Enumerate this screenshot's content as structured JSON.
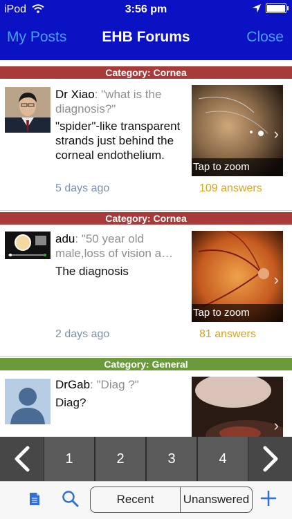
{
  "status_bar": {
    "carrier": "iPod",
    "time": "3:56 pm"
  },
  "nav": {
    "left": "My Posts",
    "title": "EHB Forums",
    "right": "Close"
  },
  "posts": [
    {
      "category": "Category: Cornea",
      "category_color": "#a83a3a",
      "author": "Dr Xiao",
      "question": ": \"what is the diagnosis?\"",
      "body": "\"spider\"-like transparent strands just behind the corneal endothelium.",
      "time": "5 days ago",
      "answers": "109 answers",
      "zoom": "Tap to zoom"
    },
    {
      "category": "Category: Cornea",
      "category_color": "#a83a3a",
      "author": "adu",
      "question": ": \"50 year old male,loss of vision a…",
      "body": "The diagnosis",
      "time": "2 days ago",
      "answers": "81 answers",
      "zoom": "Tap to zoom"
    },
    {
      "category": "Category: General",
      "category_color": "#6a9a3a",
      "author": "DrGab",
      "question": ": \"Diag ?\"",
      "body": "Diag?"
    }
  ],
  "pager": {
    "pages": [
      "1",
      "2",
      "3",
      "4"
    ]
  },
  "toolbar": {
    "recent": "Recent",
    "unanswered": "Unanswered"
  },
  "colors": {
    "header": "#0a12c4",
    "link": "#4aa0ff",
    "answers": "#d9a21b"
  }
}
